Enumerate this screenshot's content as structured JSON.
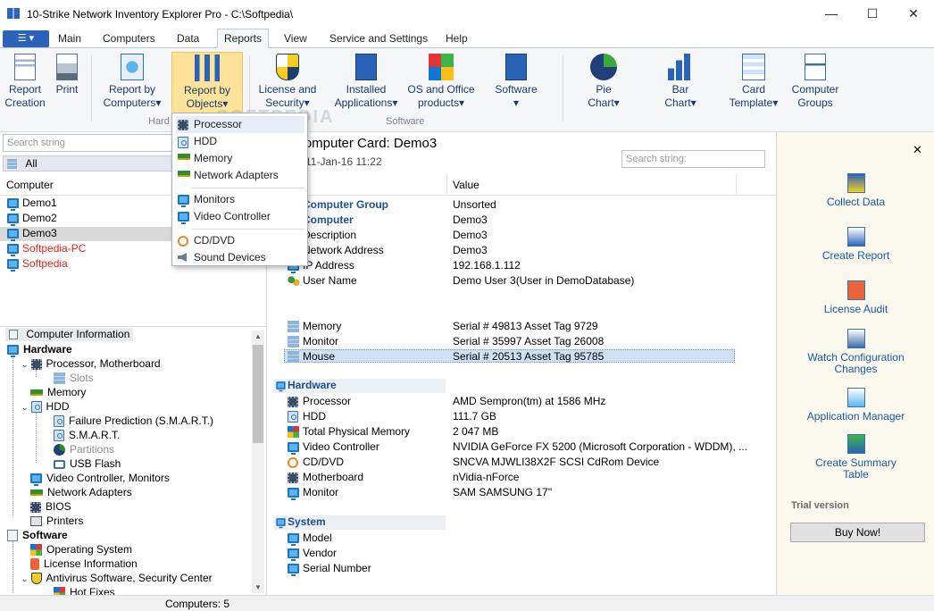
{
  "window": {
    "title": "10-Strike Network Inventory Explorer Pro - C:\\Softpedia\\",
    "minimize": "—",
    "maximize": "☐",
    "close": "✕"
  },
  "menu": {
    "file_glyph": "☰ ▾",
    "tabs": [
      "Main",
      "Computers",
      "Data",
      "Reports",
      "View",
      "Service and Settings",
      "Help"
    ],
    "active_tab": "Reports"
  },
  "ribbon": {
    "buttons": [
      {
        "label1": "Report",
        "label2": "Creation",
        "icon": "report-icon"
      },
      {
        "label1": "Print",
        "label2": "",
        "icon": "printer-icon"
      },
      {
        "label1": "Report by",
        "label2": "Computers",
        "icon": "computers-icon",
        "dropdown": true
      },
      {
        "label1": "Report by",
        "label2": "Objects",
        "icon": "objects-icon",
        "dropdown": true
      },
      {
        "label1": "License and",
        "label2": "Security",
        "icon": "shield-icon",
        "dropdown": true
      },
      {
        "label1": "Installed",
        "label2": "Applications",
        "icon": "app-icon",
        "dropdown": true
      },
      {
        "label1": "OS and Office",
        "label2": "products",
        "icon": "windows-icon",
        "dropdown": true
      },
      {
        "label1": "Software",
        "label2": "",
        "icon": "software-icon",
        "dropdown": true
      },
      {
        "label1": "Pie",
        "label2": "Chart",
        "icon": "pie-chart-icon",
        "dropdown": true
      },
      {
        "label1": "Bar",
        "label2": "Chart",
        "icon": "bar-chart-icon",
        "dropdown": true
      },
      {
        "label1": "Card",
        "label2": "Template",
        "icon": "card-template-icon",
        "dropdown": true
      },
      {
        "label1": "Computer",
        "label2": "Groups",
        "icon": "groups-icon"
      }
    ],
    "groups": [
      "Hard",
      "Software"
    ],
    "watermark": "SOFTPEDIA"
  },
  "left": {
    "search_placeholder": "Search string",
    "filter_value": "All",
    "column_header": "Computer",
    "computers": [
      {
        "name": "Demo1",
        "red": false,
        "selected": false
      },
      {
        "name": "Demo2",
        "red": false,
        "selected": false
      },
      {
        "name": "Demo3",
        "red": false,
        "selected": true
      },
      {
        "name": "Softpedia-PC",
        "red": true,
        "selected": false
      },
      {
        "name": "Softpedia",
        "red": true,
        "selected": false
      }
    ],
    "info_header": "Computer Information",
    "tree": [
      {
        "label": "Hardware",
        "bold": true
      },
      {
        "label": "Processor, Motherboard"
      },
      {
        "label": "Slots",
        "grey": true
      },
      {
        "label": "Memory"
      },
      {
        "label": "HDD"
      },
      {
        "label": "Failure Prediction (S.M.A.R.T.)"
      },
      {
        "label": "S.M.A.R.T."
      },
      {
        "label": "Partitions",
        "grey": true
      },
      {
        "label": "USB Flash"
      },
      {
        "label": "Video Controller, Monitors"
      },
      {
        "label": "Network Adapters"
      },
      {
        "label": "BIOS"
      },
      {
        "label": "Printers"
      },
      {
        "label": "Software",
        "bold": true
      },
      {
        "label": "Operating System"
      },
      {
        "label": "License Information"
      },
      {
        "label": "Antivirus Software, Security Center"
      },
      {
        "label": "Hot Fixes"
      }
    ]
  },
  "main": {
    "card_title": "Computer Card: Demo3",
    "date_line": "11-Jan-16 11:22",
    "search_placeholder": "Search string:",
    "value_header": "Value",
    "general": [
      {
        "name": "Computer Group",
        "value": "Unsorted",
        "section": true
      },
      {
        "name": "Computer",
        "value": "Demo3",
        "section": true
      },
      {
        "name": "Description",
        "value": "Demo3"
      },
      {
        "name": "Network Address",
        "value": "Demo3"
      },
      {
        "name": "IP Address",
        "value": "192.168.1.112"
      },
      {
        "name": "User Name",
        "value": "Demo User 3(User in DemoDatabase)"
      }
    ],
    "devices": [
      {
        "name": "Memory",
        "value": "Serial # 49813 Asset Tag 9729"
      },
      {
        "name": "Monitor",
        "value": "Serial # 35997 Asset Tag 26008"
      },
      {
        "name": "Mouse",
        "value": "Serial # 20513 Asset Tag 95785"
      }
    ],
    "hardware_header": "Hardware",
    "hardware": [
      {
        "name": "Processor",
        "value": "AMD Sempron(tm) at 1586 MHz"
      },
      {
        "name": "HDD",
        "value": "111.7 GB"
      },
      {
        "name": "Total Physical Memory",
        "value": "2 047 MB"
      },
      {
        "name": "Video Controller",
        "value": "NVIDIA GeForce FX 5200 (Microsoft Corporation - WDDM), ..."
      },
      {
        "name": "CD/DVD",
        "value": "SNCVA MJWLI38X2F SCSI CdRom Device"
      },
      {
        "name": "Motherboard",
        "value": "nVidia-nForce"
      },
      {
        "name": "Monitor",
        "value": "SAM SAMSUNG 17''"
      }
    ],
    "system_header": "System",
    "system": [
      {
        "name": "Model",
        "value": ""
      },
      {
        "name": "Vendor",
        "value": ""
      },
      {
        "name": "Serial Number",
        "value": ""
      }
    ]
  },
  "right": {
    "close": "✕",
    "actions": [
      {
        "label": "Collect Data"
      },
      {
        "label": "Create Report"
      },
      {
        "label": "License Audit"
      },
      {
        "label": "Watch Configuration Changes"
      },
      {
        "label": "Application Manager"
      },
      {
        "label": "Create Summary Table"
      }
    ],
    "trial": "Trial version",
    "buy": "Buy Now!"
  },
  "dropdown": {
    "items": [
      "Processor",
      "HDD",
      "Memory",
      "Network Adapters",
      "Monitors",
      "Video Controller",
      "CD/DVD",
      "Sound Devices"
    ]
  },
  "status": {
    "text": "Computers: 5"
  }
}
